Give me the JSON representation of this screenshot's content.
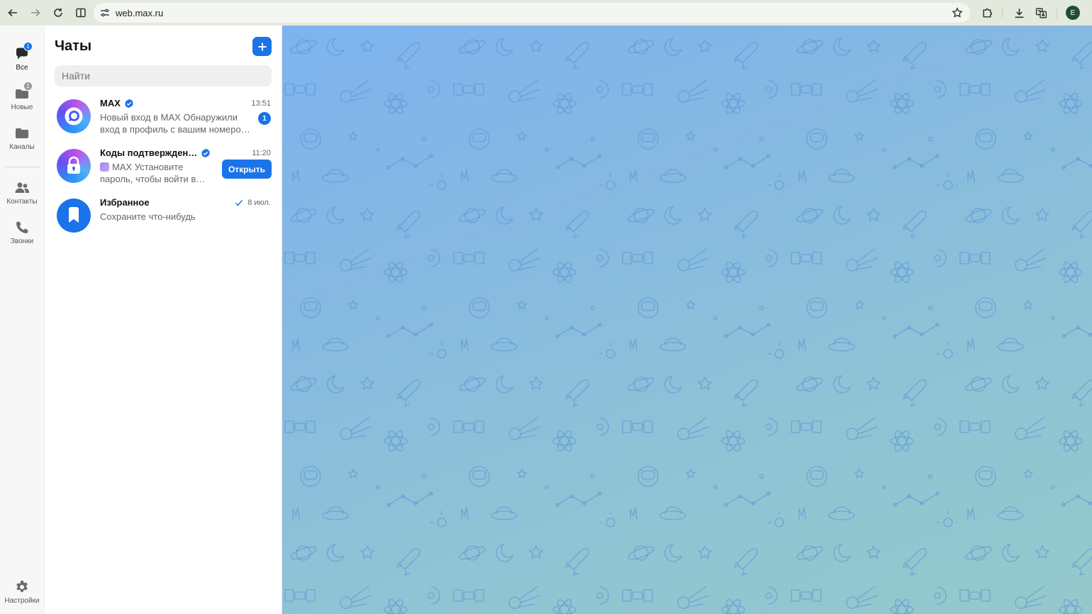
{
  "browser": {
    "url": "web.max.ru",
    "profile_initial": "E"
  },
  "rail": {
    "items": [
      {
        "label": "Все",
        "badge": "1",
        "icon": "chat-bubble-icon"
      },
      {
        "label": "Новые",
        "badge": "1",
        "icon": "new-chats-icon"
      },
      {
        "label": "Каналы",
        "icon": "folder-icon"
      },
      {
        "label": "Контакты",
        "icon": "contacts-icon"
      },
      {
        "label": "Звонки",
        "icon": "phone-icon"
      }
    ],
    "settings_label": "Настройки"
  },
  "chats": {
    "title": "Чаты",
    "search_placeholder": "Найти",
    "list": [
      {
        "name": "MAX",
        "verified": true,
        "time": "13:51",
        "line1": "Новый вход в MAX Обнаружили",
        "line2": "вход в профиль с вашим номеро…",
        "unread": "1"
      },
      {
        "name": "Коды подтвержден…",
        "verified": true,
        "time": "11:20",
        "line1": "MAX Установите",
        "line2": "пароль, чтобы войти в…",
        "action": "Открыть"
      },
      {
        "name": "Избранное",
        "time": "8 июл.",
        "line1": "Сохраните что-нибудь",
        "read_check": true
      }
    ]
  },
  "colors": {
    "accent": "#1a73e8",
    "wallpaper_top": "#7eb3ef",
    "wallpaper_bottom": "#94c9cb",
    "browser_chrome": "#e4e9de"
  }
}
